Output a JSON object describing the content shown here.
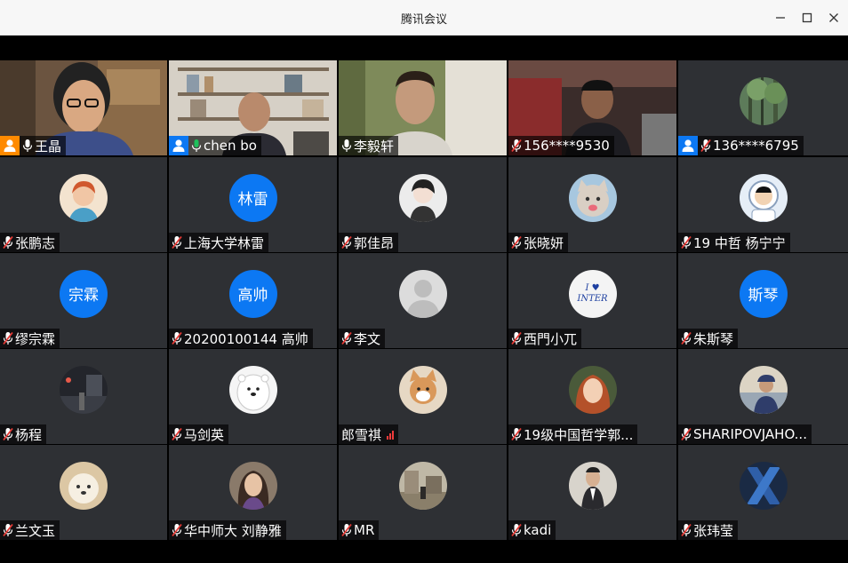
{
  "window": {
    "title": "腾讯会议"
  },
  "colors": {
    "tile_bg": "#2e3034",
    "accent_blue": "#0c78f3",
    "host_orange": "#ff8a00",
    "active_green": "#1ec05b",
    "mic_muted": "#e53935"
  },
  "participants": [
    {
      "name": "王晶",
      "video": "woman-glasses",
      "badge": "host-orange",
      "mic": "on"
    },
    {
      "name": "chen bo",
      "video": "man-bookshelf",
      "badge": "cohost-blue",
      "mic": "active",
      "active": true
    },
    {
      "name": "李毅轩",
      "video": "young-man",
      "mic": "on"
    },
    {
      "name": "156****9530",
      "video": "man-dark-room",
      "mic": "muted"
    },
    {
      "name": "136****6795",
      "avatar": "forest",
      "badge": "cohost-blue",
      "mic": "muted"
    },
    {
      "name": "张鹏志",
      "avatar": "cartoon-girl",
      "mic": "muted"
    },
    {
      "name": "上海大学林雷",
      "avatar_text": "林雷",
      "mic": "muted"
    },
    {
      "name": "郭佳昂",
      "avatar": "anime-boy",
      "mic": "muted"
    },
    {
      "name": "张晓妍",
      "avatar": "cat",
      "mic": "muted"
    },
    {
      "name": "19 中哲 杨宁宁",
      "avatar": "astronaut-kid",
      "mic": "muted"
    },
    {
      "name": "缪宗霖",
      "avatar_text": "宗霖",
      "mic": "muted"
    },
    {
      "name": "20200100144 高帅",
      "avatar_text": "高帅",
      "mic": "muted"
    },
    {
      "name": "李文",
      "avatar": "default-person",
      "mic": "muted"
    },
    {
      "name": "西門小兀",
      "avatar": "i-love-inter",
      "avatar_caption": "I ♥ INTER",
      "mic": "muted"
    },
    {
      "name": "朱斯琴",
      "avatar_text": "斯琴",
      "mic": "muted"
    },
    {
      "name": "杨程",
      "avatar": "night-street",
      "mic": "muted"
    },
    {
      "name": "马剑英",
      "avatar": "polar-bear",
      "mic": "muted"
    },
    {
      "name": "郎雪祺",
      "avatar": "corgi",
      "signal": "weak"
    },
    {
      "name": "19级中国哲学郭...",
      "avatar": "red-hair-girl",
      "mic": "muted"
    },
    {
      "name": "SHARIPOVJAHO...",
      "avatar": "cap-man",
      "mic": "muted"
    },
    {
      "name": "兰文玉",
      "avatar": "fluffy-dog",
      "mic": "muted"
    },
    {
      "name": "华中师大 刘静雅",
      "avatar": "girl-portrait",
      "mic": "muted"
    },
    {
      "name": "MR",
      "avatar": "street-scene",
      "mic": "muted"
    },
    {
      "name": "kadi",
      "avatar": "man-suit",
      "mic": "muted"
    },
    {
      "name": "张玮莹",
      "avatar": "x-letter",
      "mic": "muted"
    }
  ]
}
